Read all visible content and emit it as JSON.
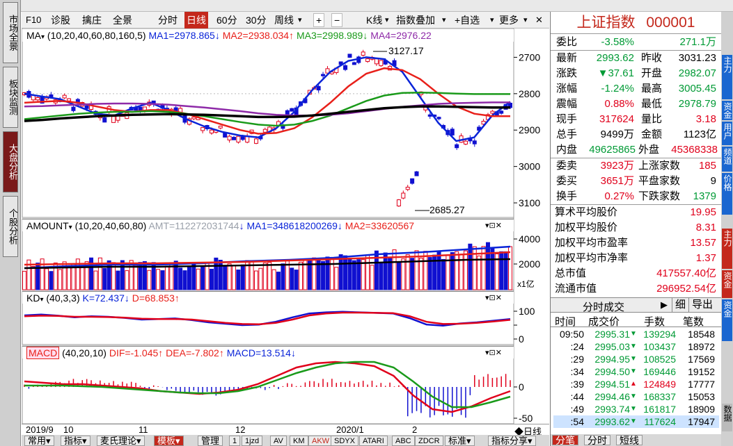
{
  "left_tabs": [
    {
      "label": "市场全景",
      "active": false
    },
    {
      "label": "板块监测",
      "active": false
    },
    {
      "label": "大盘分析",
      "active": true
    },
    {
      "label": "个股分析",
      "active": false
    }
  ],
  "toolbar": {
    "f10": "F10",
    "diagnose": "诊股",
    "select": "擒庄",
    "panorama": "全景",
    "minute": "分时",
    "daily": "日线",
    "m60": "60分",
    "m30": "30分",
    "weekly": "周线",
    "plus": "+",
    "minus": "−",
    "kline": "K线",
    "index_overlay": "指数叠加",
    "add_watch": "+自选",
    "more": "更多",
    "close": "✕"
  },
  "ma_legend": {
    "name": "MA",
    "params": "(10,20,40,60,80,160,5)",
    "ma1": "MA1=2978.865",
    "ma2": "MA2=2938.034",
    "ma3": "MA3=2998.989",
    "ma4": "MA4=2976.22"
  },
  "amount_legend": {
    "name": "AMOUNT",
    "params": "(10,20,40,60,80)",
    "amt": "AMT=112272031744",
    "ma1": "MA1=348618200269",
    "ma2": "MA2=33620567"
  },
  "kd_legend": {
    "name": "KD",
    "params": "(40,3,3)",
    "k": "K=72.437",
    "d": "D=68.853"
  },
  "macd_legend": {
    "name": "MACD",
    "params": "(40,20,10)",
    "dif": "DIF=-1.045",
    "dea": "DEA=-7.802",
    "macd": "MACD=13.514"
  },
  "arrows": {
    "up": "↑",
    "down": "↓"
  },
  "price_axis": [
    "3100",
    "3000",
    "2900",
    "2800",
    "2700"
  ],
  "amount_axis": [
    "4000",
    "2000"
  ],
  "amount_unit": "x1亿",
  "kd_axis": [
    "100",
    "50",
    "0"
  ],
  "macd_axis": [
    "0",
    "-50"
  ],
  "annotations": {
    "high": "3127.17",
    "low": "2685.27"
  },
  "date_axis": [
    "2019/9",
    "10",
    "11",
    "12",
    "2020/1",
    "2"
  ],
  "daily_label": "◆日线",
  "bottom_tabs": [
    "常用",
    "指标",
    "麦氏理论",
    "模板",
    "管理",
    "1",
    "1jzd",
    "AV",
    "KM",
    "AKW",
    "SDYX",
    "ATARI",
    "ABC",
    "ZDCR",
    "标准",
    "指标分享"
  ],
  "quote": {
    "title": "上证指数",
    "code": "000001",
    "weibi_label": "委比",
    "weibi": "-3.58%",
    "weicha": "271.1万",
    "last_label": "最新",
    "last": "2993.62",
    "prev_label": "昨收",
    "prev": "3031.23",
    "chg_label": "涨跌",
    "chg": "▼37.61",
    "open_label": "开盘",
    "open": "2982.07",
    "pct_label": "涨幅",
    "pct": "-1.24%",
    "high_label": "最高",
    "high": "3005.45",
    "amp_label": "震幅",
    "amp": "0.88%",
    "low_label": "最低",
    "low": "2978.79",
    "now_vol_label": "现手",
    "now_vol": "317624",
    "vol_ratio_label": "量比",
    "vol_ratio": "3.18",
    "total_vol_label": "总手",
    "total_vol": "9499万",
    "amount_label": "金额",
    "amount": "1123亿",
    "inner_label": "内盘",
    "inner": "49625865",
    "outer_label": "外盘",
    "outer": "45368338",
    "ask_label": "委卖",
    "ask": "3923万",
    "up_count_label": "上涨家数",
    "up_count": "185",
    "bid_label": "委买",
    "bid": "3651万",
    "flat_count_label": "平盘家数",
    "flat_count": "9",
    "turnover_label": "换手",
    "turnover": "0.27%",
    "down_count_label": "下跌家数",
    "down_count": "1379",
    "avg_price_label": "算术平均股价",
    "avg_price": "19.95",
    "wavg_price_label": "加权平均股价",
    "wavg_price": "8.31",
    "wpe_label": "加权平均市盈率",
    "wpe": "13.57",
    "wpb_label": "加权平均市净率",
    "wpb": "1.37",
    "total_mv_label": "总市值",
    "total_mv": "417557.40亿",
    "float_mv_label": "流通市值",
    "float_mv": "296952.54亿"
  },
  "tick_panel": {
    "title": "分时成交",
    "arrow": "▶",
    "detail": "细",
    "export": "导出",
    "headers": [
      "时间",
      "成交价",
      "手数",
      "笔数"
    ],
    "rows": [
      {
        "time": "09:50",
        "price": "2995.31",
        "vol": "139294",
        "count": "18548",
        "dir": "down"
      },
      {
        "time": ":24",
        "price": "2995.03",
        "vol": "103437",
        "count": "18972",
        "dir": "down"
      },
      {
        "time": ":29",
        "price": "2994.95",
        "vol": "108525",
        "count": "17569",
        "dir": "down"
      },
      {
        "time": ":34",
        "price": "2994.50",
        "vol": "169446",
        "count": "19152",
        "dir": "down"
      },
      {
        "time": ":39",
        "price": "2994.51",
        "vol": "124849",
        "count": "17777",
        "dir": "up"
      },
      {
        "time": ":44",
        "price": "2994.46",
        "vol": "168337",
        "count": "15053",
        "dir": "down"
      },
      {
        "time": ":49",
        "price": "2993.74",
        "vol": "161817",
        "count": "18909",
        "dir": "down"
      },
      {
        "time": ":54",
        "price": "2993.62",
        "vol": "117624",
        "count": "17947",
        "dir": "down"
      }
    ]
  },
  "right_bottom_tabs": [
    "分笔",
    "分时",
    "短线"
  ],
  "right_strip": [
    "主力",
    "资金",
    "用户",
    "频道",
    "价格",
    "主力",
    "资金",
    "资金",
    "数据"
  ],
  "colors": {
    "up": "#e0001b",
    "down": "#1010d0",
    "ma1": "#0a24d8",
    "ma2": "#e8201a",
    "ma3": "#1a9a1a",
    "ma4": "#8e2aa8",
    "ma5": "#000000",
    "accent": "#c4281c"
  },
  "chart_data": {
    "type": "line",
    "title": "",
    "x_range": [
      "2019/9",
      "2020/2"
    ],
    "y_range": [
      2660,
      3160
    ],
    "visible_ticks": [
      2700,
      2800,
      2900,
      3000,
      3100
    ],
    "annotated_high": 3127.17,
    "annotated_low": 2685.27,
    "series": [
      {
        "name": "MA1",
        "values": [
          3000,
          2992,
          2985,
          2965,
          2945,
          2940,
          2960,
          2975,
          2955,
          2930,
          2910,
          2895,
          2885,
          2880,
          2905,
          2950,
          3010,
          3060,
          3090,
          3100,
          3095,
          3060,
          2990,
          2920,
          2870,
          2880,
          2940,
          2978
        ]
      },
      {
        "name": "MA2",
        "values": [
          2975,
          2978,
          2980,
          2975,
          2965,
          2955,
          2950,
          2955,
          2955,
          2945,
          2930,
          2915,
          2900,
          2890,
          2892,
          2905,
          2935,
          2975,
          3020,
          3055,
          3070,
          3065,
          3040,
          3000,
          2965,
          2945,
          2938,
          2938
        ]
      },
      {
        "name": "MA3",
        "values": [
          2930,
          2935,
          2940,
          2945,
          2948,
          2950,
          2950,
          2952,
          2950,
          2945,
          2938,
          2930,
          2922,
          2915,
          2912,
          2915,
          2925,
          2940,
          2960,
          2980,
          2995,
          3002,
          3003,
          3002,
          3000,
          2999,
          2999,
          2999
        ]
      },
      {
        "name": "MA4",
        "values": [
          2965,
          2966,
          2968,
          2970,
          2972,
          2973,
          2973,
          2972,
          2970,
          2966,
          2962,
          2957,
          2952,
          2946,
          2942,
          2940,
          2940,
          2942,
          2946,
          2952,
          2958,
          2964,
          2968,
          2972,
          2974,
          2975,
          2976,
          2976
        ]
      },
      {
        "name": "MA5",
        "values": [
          2925,
          2928,
          2932,
          2935,
          2938,
          2940,
          2942,
          2943,
          2944,
          2943,
          2942,
          2940,
          2938,
          2936,
          2936,
          2937,
          2940,
          2945,
          2950,
          2955,
          2960,
          2963,
          2965,
          2965,
          2964,
          2963,
          2962,
          2962
        ]
      }
    ]
  }
}
